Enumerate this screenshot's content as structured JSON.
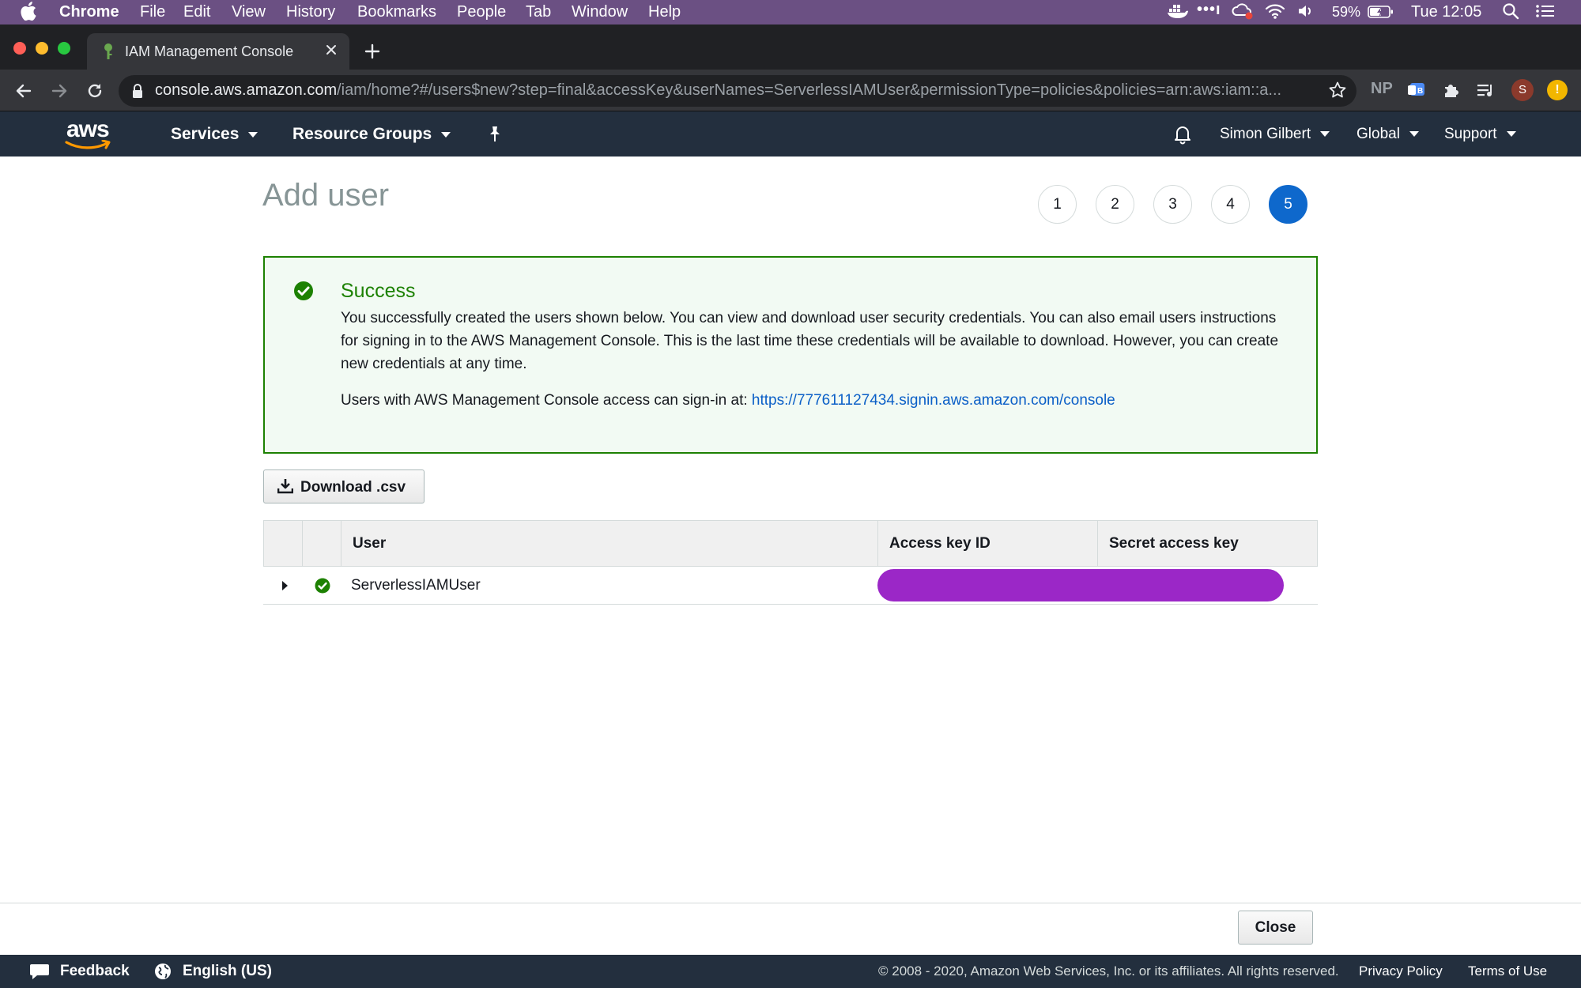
{
  "menubar": {
    "app": "Chrome",
    "items": [
      "File",
      "Edit",
      "View",
      "History",
      "Bookmarks",
      "People",
      "Tab",
      "Window",
      "Help"
    ],
    "battery": "59%",
    "clock": "Tue 12:05"
  },
  "browser": {
    "tab_title": "IAM Management Console",
    "url_host": "console.aws.amazon.com",
    "url_path": "/iam/home?#/users$new?step=final&accessKey&userNames=ServerlessIAMUser&permissionType=policies&policies=arn:aws:iam::a...",
    "profile_initial": "S"
  },
  "awsnav": {
    "logo": "aws",
    "services": "Services",
    "resource_groups": "Resource Groups",
    "user": "Simon Gilbert",
    "region": "Global",
    "support": "Support"
  },
  "page": {
    "title": "Add user",
    "steps": [
      "1",
      "2",
      "3",
      "4",
      "5"
    ],
    "active_step": "5"
  },
  "success": {
    "title": "Success",
    "message": "You successfully created the users shown below. You can view and download user security credentials. You can also email users instructions for signing in to the AWS Management Console. This is the last time these credentials will be available to download. However, you can create new credentials at any time.",
    "signin_prefix": "Users with AWS Management Console access can sign-in at:",
    "signin_url": "https://777611127434.signin.aws.amazon.com/console"
  },
  "actions": {
    "download": "Download .csv",
    "close": "Close"
  },
  "table": {
    "headers": [
      "User",
      "Access key ID",
      "Secret access key"
    ],
    "rows": [
      {
        "user": "ServerlessIAMUser"
      }
    ]
  },
  "footer": {
    "feedback": "Feedback",
    "language": "English (US)",
    "copyright": "© 2008 - 2020, Amazon Web Services, Inc. or its affiliates. All rights reserved.",
    "privacy": "Privacy Policy",
    "terms": "Terms of Use"
  },
  "colors": {
    "success_green": "#1d8102",
    "aws_nav": "#232f3e",
    "active_step": "#0e68cc",
    "link": "#0b5fc7",
    "redaction": "#9b27c7"
  }
}
